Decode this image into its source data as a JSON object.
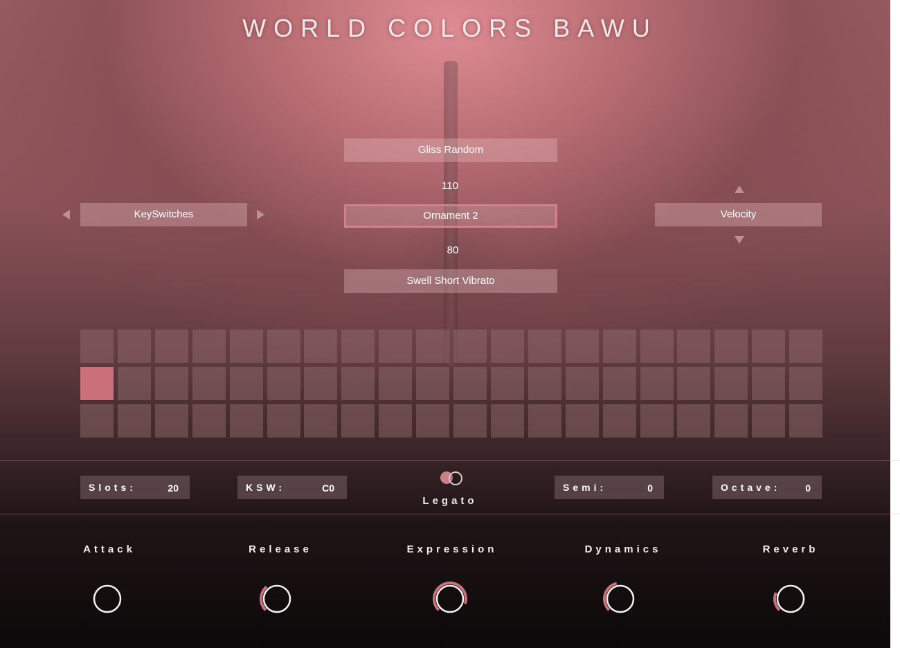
{
  "header": {
    "title": "WORLD COLORS BAWU"
  },
  "articulations": {
    "top_label": "Gliss Random",
    "top_value": "110",
    "selected_label": "Ornament 2",
    "bottom_value": "80",
    "bottom_label": "Swell Short Vibrato"
  },
  "left_selector": {
    "label": "KeySwitches",
    "prev_icon": "triangle-left-icon",
    "next_icon": "triangle-right-icon"
  },
  "right_selector": {
    "label": "Velocity",
    "up_icon": "triangle-up-icon",
    "down_icon": "triangle-down-icon"
  },
  "slot_grid": {
    "rows": 3,
    "columns": 20,
    "active_slot": {
      "row": 2,
      "column": 1
    }
  },
  "settings": {
    "slots": {
      "label": "Slots:",
      "value": "20"
    },
    "ksw": {
      "label": "KSW:",
      "value": "C0"
    },
    "legato": {
      "label": "Legato",
      "on": true
    },
    "semi": {
      "label": "Semi:",
      "value": "0"
    },
    "octave": {
      "label": "Octave:",
      "value": "0"
    }
  },
  "knobs": [
    {
      "label": "Attack",
      "level": 0.0
    },
    {
      "label": "Release",
      "level": 0.35
    },
    {
      "label": "Expression",
      "level": 0.9
    },
    {
      "label": "Dynamics",
      "level": 0.45
    },
    {
      "label": "Reverb",
      "level": 0.25
    }
  ],
  "colors": {
    "accent": "#c97078",
    "panel": "#9a5e64",
    "dark": "#0c0809"
  }
}
